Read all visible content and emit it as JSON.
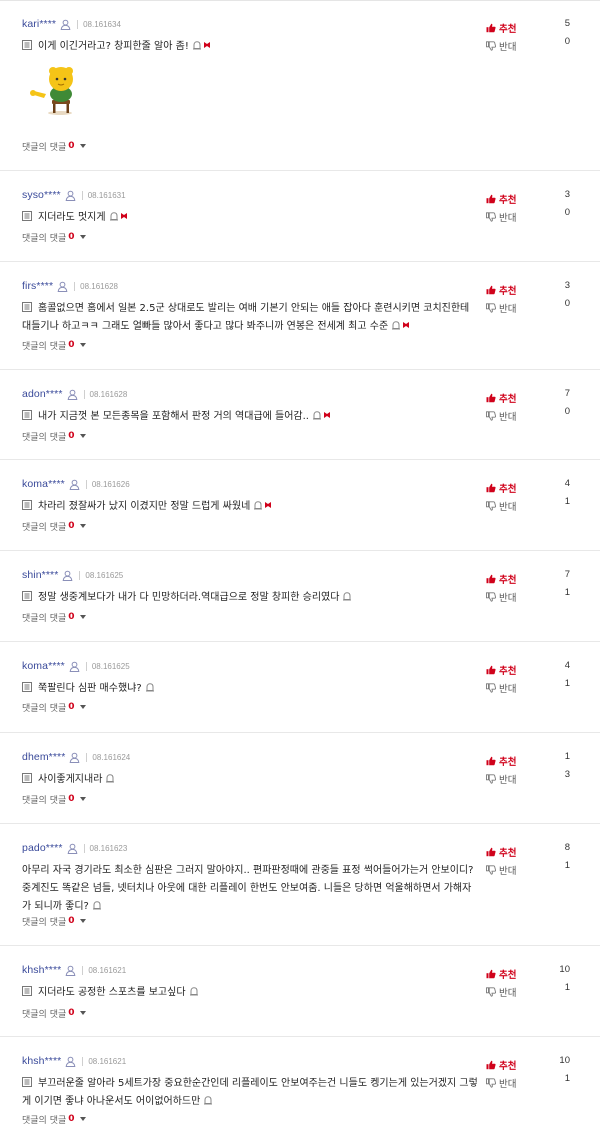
{
  "labels": {
    "replies": "댓글의 댓글",
    "upvote": "추천",
    "downvote": "반대"
  },
  "colors": {
    "accent": "#d0021b",
    "username": "#3a4a9a",
    "divider": "#e8e8e8"
  },
  "icons": {
    "user": "person-outline-icon",
    "report": "siren-icon",
    "block": "block-icon",
    "flag": "document-icon",
    "up": "thumb-up-icon",
    "down": "thumb-down-icon",
    "caret": "caret-down-icon"
  },
  "comments": [
    {
      "user": "kari****",
      "date": "08.161634",
      "text": "이게 이긴거라고? 창피한줄 알아 좀!",
      "replies": "0",
      "up": "5",
      "down": "0",
      "sticker": true,
      "lines": 1
    },
    {
      "user": "syso****",
      "date": "08.161631",
      "text": "지더라도 멋지게",
      "replies": "0",
      "up": "3",
      "down": "0",
      "lines": 1
    },
    {
      "user": "firs****",
      "date": "08.161628",
      "text": "홈콜없으면 홈에서 일본 2.5군 상대로도 발리는 여배 기본기 안되는 애들 잡아다 훈련시키면 코치진한테 대들기나 하고ㅋㅋ 그래도 얼빠들 많아서 좋다고 많다 봐주니까 연봉은 전세계 최고 수준",
      "replies": "0",
      "up": "3",
      "down": "0",
      "lines": 2
    },
    {
      "user": "adon****",
      "date": "08.161628",
      "text": "내가 지금껏 본 모든종목을 포함해서 판정 거의 역대급에 들어감..",
      "replies": "0",
      "up": "7",
      "down": "0",
      "lines": 1
    },
    {
      "user": "koma****",
      "date": "08.161626",
      "text": "차라리 졌잘싸가 났지 이겼지만 정말 드럽게 싸웠네",
      "replies": "0",
      "up": "4",
      "down": "1",
      "lines": 1
    },
    {
      "user": "shin****",
      "date": "08.161625",
      "text": "정말 생중계보다가 내가 다 민망하더라.역대급으로 정말 창피한 승리였다",
      "replies": "0",
      "up": "7",
      "down": "1",
      "lines": 1,
      "noblock": true
    },
    {
      "user": "koma****",
      "date": "08.161625",
      "text": "쭉팔린다 심판 매수했냐?",
      "replies": "0",
      "up": "4",
      "down": "1",
      "lines": 1,
      "noblock": true
    },
    {
      "user": "dhem****",
      "date": "08.161624",
      "text": "사이좋게지내라",
      "replies": "0",
      "up": "1",
      "down": "3",
      "lines": 1,
      "noblock": true
    },
    {
      "user": "pado****",
      "date": "08.161623",
      "text": "아무리 자국 경기라도 최소한 심판은 그러지 말아야지.. 편파판정때에 관중들 표정 썩어들어가는거 안보이디? 중계진도 똑같은 넘들, 넷터치나 아웃에 대한 리플레이 한번도 안보여줌. 니들은 당하면 억울해하면서 가해자가 되니까 좋디?",
      "replies": "0",
      "up": "8",
      "down": "1",
      "lines": 3,
      "noflag": true,
      "noblock": true
    },
    {
      "user": "khsh****",
      "date": "08.161621",
      "text": "지더라도 공정한 스포츠를 보고싶다",
      "replies": "0",
      "up": "10",
      "down": "1",
      "lines": 1,
      "noblock": true
    },
    {
      "user": "khsh****",
      "date": "08.161621",
      "text": "부끄러운줄 알아라 5세트가장 중요한순간인데 리플레이도 안보여주는건 니들도 켕기는게 있는거겠지 그렇게 이기면 좋냐 아나운서도 어이없어하드만",
      "replies": "0",
      "up": "10",
      "down": "1",
      "lines": 2,
      "noblock": true
    }
  ]
}
